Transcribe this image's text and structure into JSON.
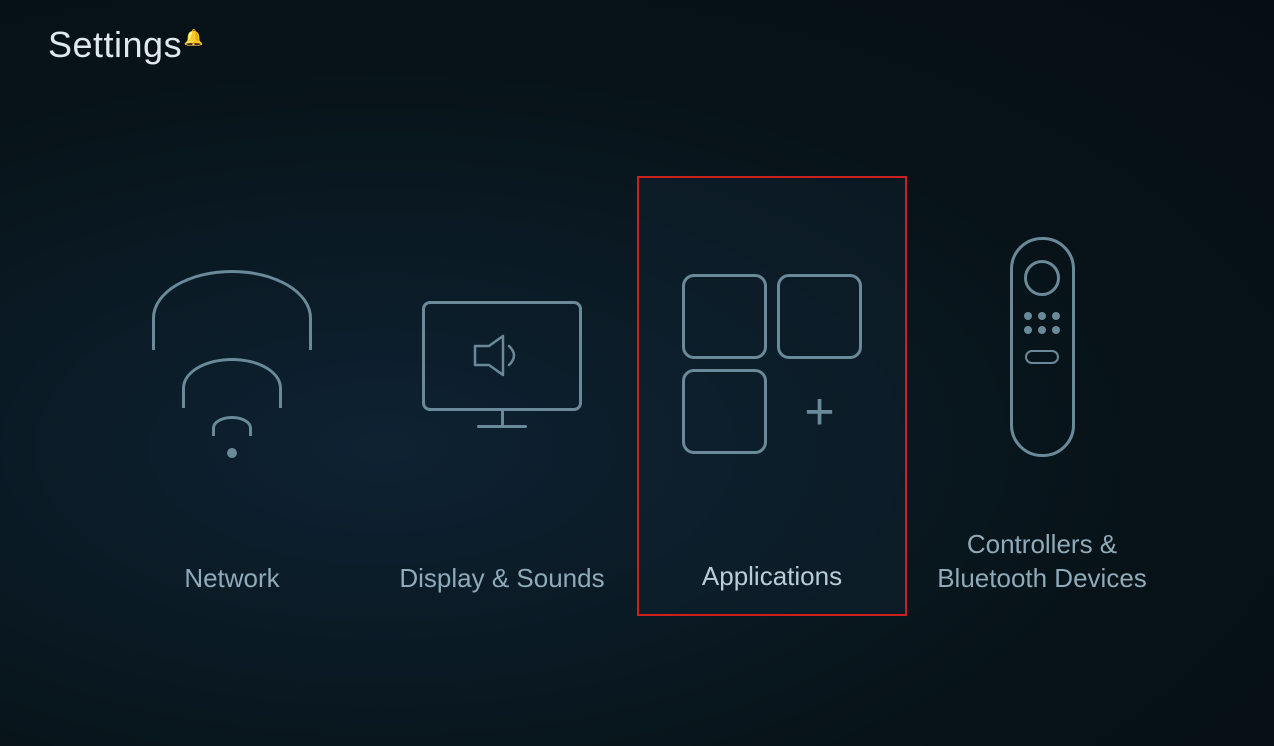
{
  "header": {
    "title": "Settings",
    "bell_icon": "🔔"
  },
  "items": [
    {
      "id": "network",
      "label": "Network",
      "active": false,
      "icon_type": "wifi"
    },
    {
      "id": "display-sounds",
      "label": "Display & Sounds",
      "active": false,
      "icon_type": "tv"
    },
    {
      "id": "applications",
      "label": "Applications",
      "active": true,
      "icon_type": "apps"
    },
    {
      "id": "controllers-bluetooth",
      "label": "Controllers &\nBluetooth Devices",
      "active": false,
      "icon_type": "remote"
    }
  ],
  "colors": {
    "background": "#0d1f2d",
    "icon_stroke": "#6a8a9a",
    "label_inactive": "#8faab8",
    "label_active": "#b8cdd8",
    "active_border": "#cc2020",
    "header_text": "#e0e8ee"
  }
}
